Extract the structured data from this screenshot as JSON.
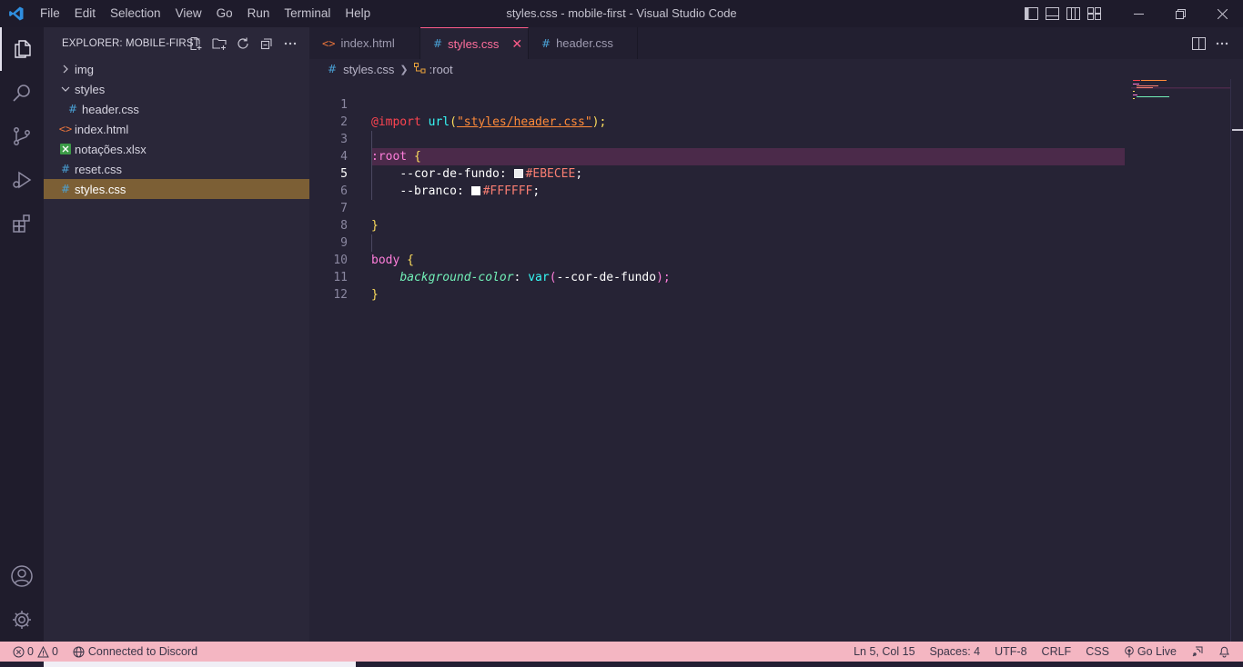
{
  "window": {
    "title": "styles.css - mobile-first - Visual Studio Code",
    "menu": [
      "File",
      "Edit",
      "Selection",
      "View",
      "Go",
      "Run",
      "Terminal",
      "Help"
    ]
  },
  "sidebar": {
    "title": "EXPLORER: MOBILE-FIRST",
    "items": [
      {
        "label": "img",
        "type": "folder-collapsed"
      },
      {
        "label": "styles",
        "type": "folder-open"
      },
      {
        "label": "header.css",
        "type": "css"
      },
      {
        "label": "index.html",
        "type": "html"
      },
      {
        "label": "notações.xlsx",
        "type": "xlsx"
      },
      {
        "label": "reset.css",
        "type": "css"
      },
      {
        "label": "styles.css",
        "type": "css",
        "selected": true
      }
    ]
  },
  "tabs": [
    {
      "label": "index.html",
      "icon": "html-icon"
    },
    {
      "label": "styles.css",
      "icon": "css-hash-icon",
      "active": true
    },
    {
      "label": "header.css",
      "icon": "css-hash-icon"
    }
  ],
  "breadcrumb": {
    "file": "styles.css",
    "symbol": ":root"
  },
  "editor": {
    "current_line": 5,
    "lines": {
      "l1": {
        "n": "1",
        "at": "@import",
        "fn": "url",
        "open": "(",
        "str": "\"styles/header.css\"",
        "close": ");"
      },
      "l2": {
        "n": "2"
      },
      "l3": {
        "n": "3",
        "sel": ":root",
        "brace": "{"
      },
      "l4": {
        "n": "4",
        "var": "--cor-de-fundo",
        "colon": ":",
        "val": "#EBECEE",
        "semi": ";"
      },
      "l5": {
        "n": "5",
        "var": "--branco",
        "colon": ":",
        "val": "#FFFFFF",
        "semi": ";"
      },
      "l6": {
        "n": "6"
      },
      "l7": {
        "n": "7",
        "brace": "}"
      },
      "l8": {
        "n": "8"
      },
      "l9": {
        "n": "9",
        "sel": "body",
        "brace": "{"
      },
      "l10": {
        "n": "10",
        "prop": "background-color",
        "colon": ":",
        "fn": "var",
        "open": "(",
        "arg": "--cor-de-fundo",
        "close": ");"
      },
      "l11": {
        "n": "11",
        "brace": "}"
      },
      "l12": {
        "n": "12"
      }
    }
  },
  "status": {
    "errors": "0",
    "warnings": "0",
    "discord": "Connected to Discord",
    "position": "Ln 5, Col 15",
    "spaces": "Spaces: 4",
    "encoding": "UTF-8",
    "eol": "CRLF",
    "language": "CSS",
    "golive": "Go Live"
  },
  "colors": {
    "accent": "#ff5c8a",
    "statusbar": "#f4b6c2",
    "selected_row": "#7c5f35",
    "swatch_1": "#EBECEE",
    "swatch_2": "#FFFFFF"
  }
}
